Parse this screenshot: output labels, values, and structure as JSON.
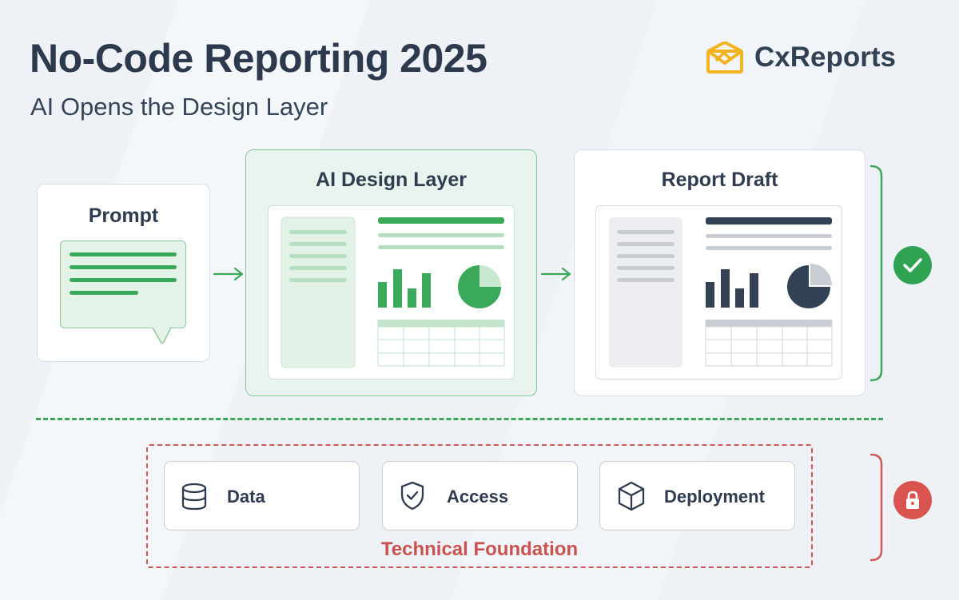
{
  "header": {
    "title": "No-Code Reporting 2025",
    "subtitle": "AI Opens the Design Layer"
  },
  "brand": {
    "name": "CxReports",
    "logo_icon": "envelope-logo-icon",
    "logo_color": "#f2b321"
  },
  "flow": {
    "prompt": {
      "title": "Prompt",
      "icon": "chat-bubble-icon"
    },
    "design_layer": {
      "title": "AI Design Layer",
      "accent": "#3aa95a"
    },
    "report_draft": {
      "title": "Report Draft",
      "accent": "#334155"
    },
    "status_icon": "check-icon",
    "status_color": "#2fa352"
  },
  "foundation": {
    "label": "Technical Foundation",
    "items": [
      {
        "label": "Data",
        "icon": "database-icon"
      },
      {
        "label": "Access",
        "icon": "shield-check-icon"
      },
      {
        "label": "Deployment",
        "icon": "cube-icon"
      }
    ],
    "status_icon": "lock-icon",
    "status_color": "#d9534f"
  },
  "colors": {
    "green": "#3aa95a",
    "red": "#cc5a57",
    "navy": "#2d3a4d"
  }
}
